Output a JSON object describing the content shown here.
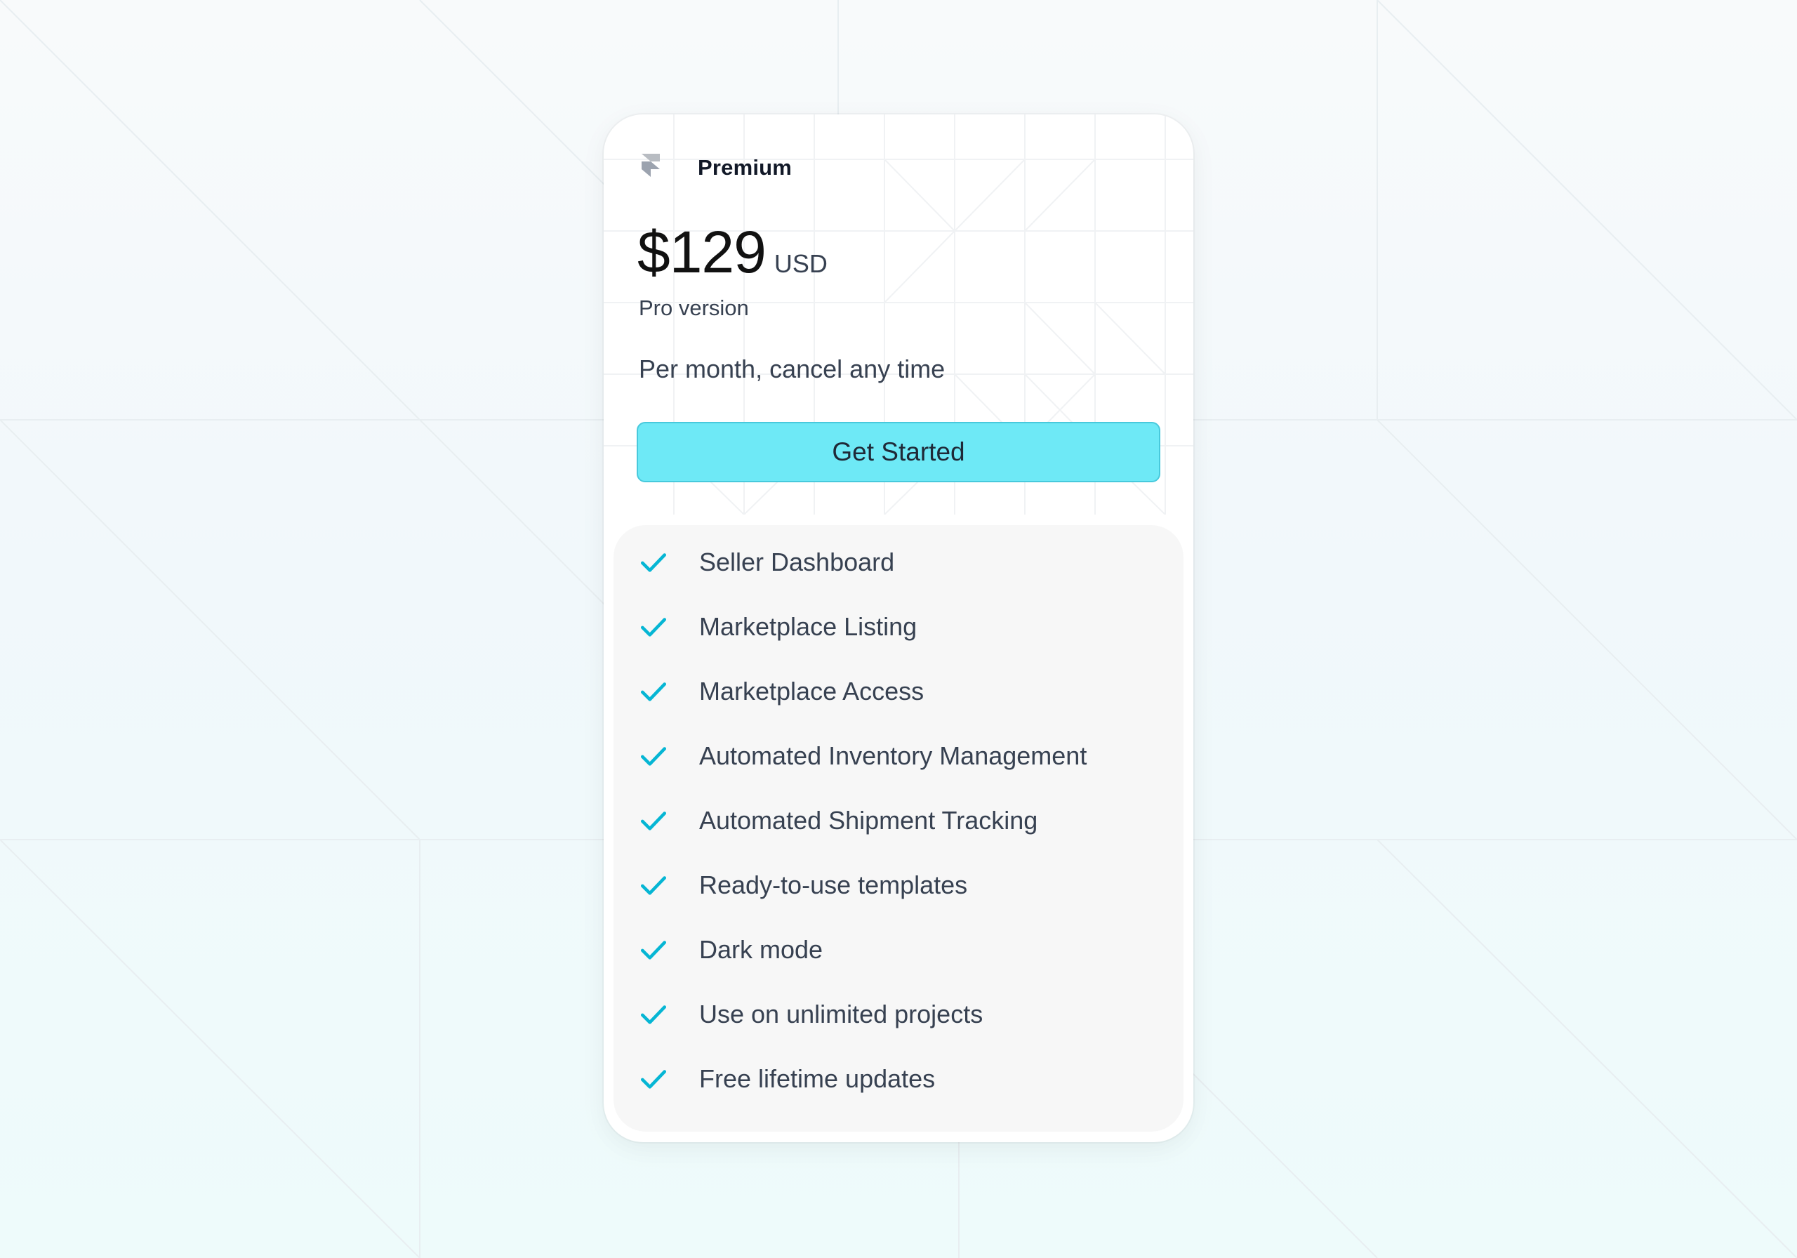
{
  "colors": {
    "accent": "#06b6d4",
    "button_bg": "#6ee9f6",
    "features_bg": "#f7f7f7"
  },
  "plan": {
    "logo_icon": "framer-logo-icon",
    "name": "Premium",
    "price": "$129",
    "currency": "USD",
    "version": "Pro version",
    "billing_note": "Per month, cancel any time",
    "cta_label": "Get Started"
  },
  "features": {
    "check_icon": "check-icon",
    "items": [
      "Seller Dashboard",
      "Marketplace Listing",
      "Marketplace Access",
      "Automated Inventory Management",
      "Automated Shipment Tracking",
      "Ready-to-use templates",
      "Dark mode",
      "Use on unlimited projects",
      "Free lifetime updates"
    ]
  }
}
